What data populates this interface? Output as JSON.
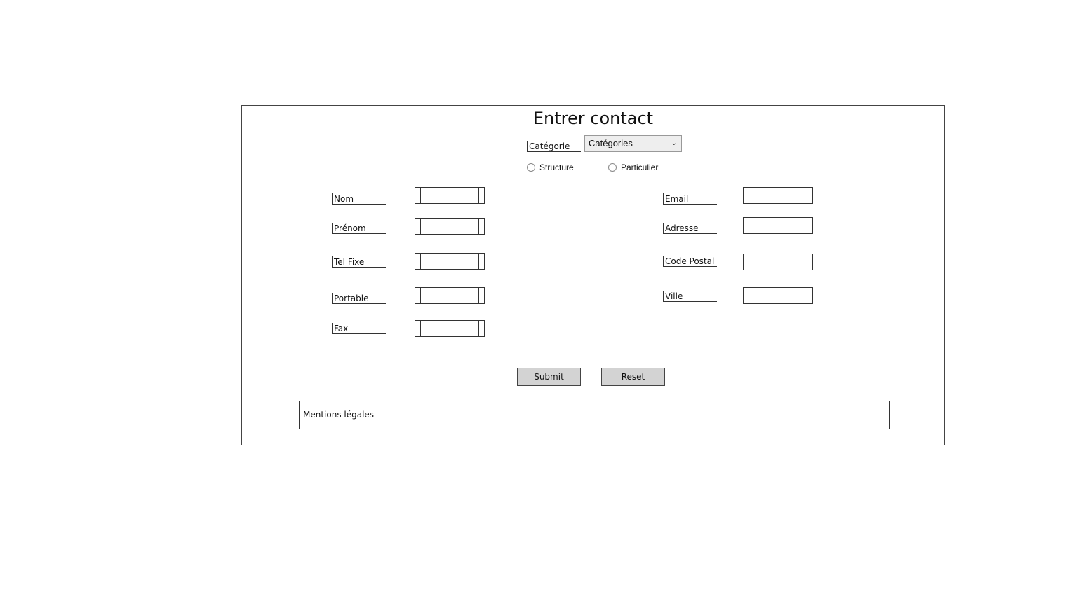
{
  "form": {
    "title": "Entrer contact",
    "categorie_label": "Catégorie",
    "categorie_select": {
      "selected": "Catégories"
    },
    "radio": {
      "structure": "Structure",
      "particulier": "Particulier"
    },
    "left_fields": [
      {
        "label": "Nom",
        "value": ""
      },
      {
        "label": "Prénom",
        "value": ""
      },
      {
        "label": "Tel Fixe",
        "value": ""
      },
      {
        "label": "Portable",
        "value": ""
      },
      {
        "label": "Fax",
        "value": ""
      }
    ],
    "right_fields": [
      {
        "label": "Email",
        "value": ""
      },
      {
        "label": "Adresse",
        "value": ""
      },
      {
        "label": "Code Postal",
        "value": ""
      },
      {
        "label": "Ville",
        "value": ""
      }
    ],
    "buttons": {
      "submit": "Submit",
      "reset": "Reset"
    },
    "mentions": "Mentions légales"
  }
}
